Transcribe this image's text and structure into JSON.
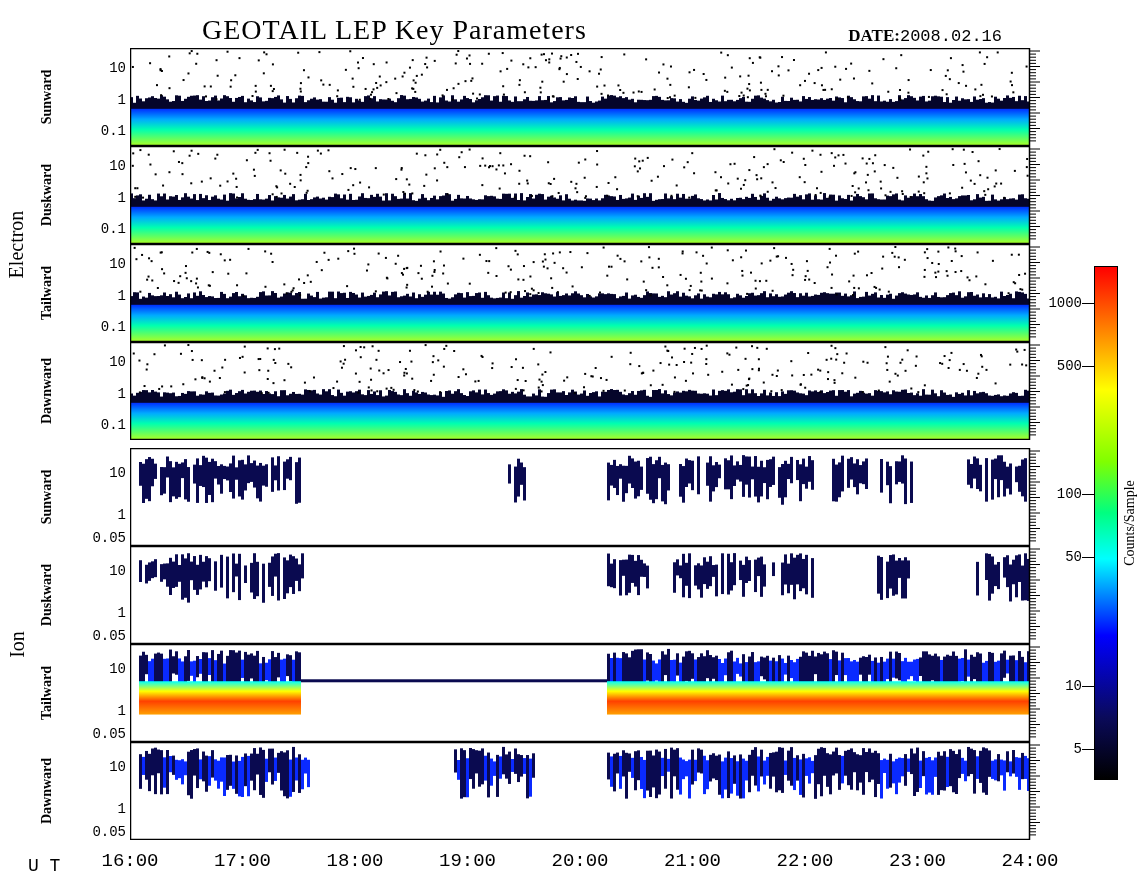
{
  "title": "GEOTAIL LEP Key Parameters",
  "date": {
    "label": "DATE:",
    "value": "2008.02.16"
  },
  "groups": [
    {
      "name": "Electron",
      "panels": [
        {
          "label": "Sunward",
          "kind": "electron",
          "yticks": [
            "10",
            "1",
            "0.1"
          ]
        },
        {
          "label": "Duskward",
          "kind": "electron",
          "yticks": [
            "10",
            "1",
            "0.1"
          ]
        },
        {
          "label": "Tailward",
          "kind": "electron",
          "yticks": [
            "10",
            "1",
            "0.1"
          ]
        },
        {
          "label": "Dawnward",
          "kind": "electron",
          "yticks": [
            "10",
            "1",
            "0.1"
          ]
        }
      ]
    },
    {
      "name": "Ion",
      "panels": [
        {
          "label": "Sunward",
          "kind": "ion",
          "yticks": [
            "10",
            "1",
            "0.05"
          ]
        },
        {
          "label": "Duskward",
          "kind": "ion",
          "yticks": [
            "10",
            "1",
            "0.05"
          ]
        },
        {
          "label": "Tailward",
          "kind": "ion",
          "yticks": [
            "10",
            "1",
            "0.05"
          ]
        },
        {
          "label": "Dawnward",
          "kind": "ion",
          "yticks": [
            "10",
            "1",
            "0.05"
          ]
        }
      ]
    }
  ],
  "time_axis": {
    "label": "U T",
    "ticks": [
      "16:00",
      "17:00",
      "18:00",
      "19:00",
      "20:00",
      "21:00",
      "22:00",
      "23:00",
      "24:00"
    ]
  },
  "colorbar": {
    "title": "Counts/Sample",
    "ticks": [
      "1000",
      "500",
      "100",
      "50",
      "10",
      "5"
    ]
  }
}
